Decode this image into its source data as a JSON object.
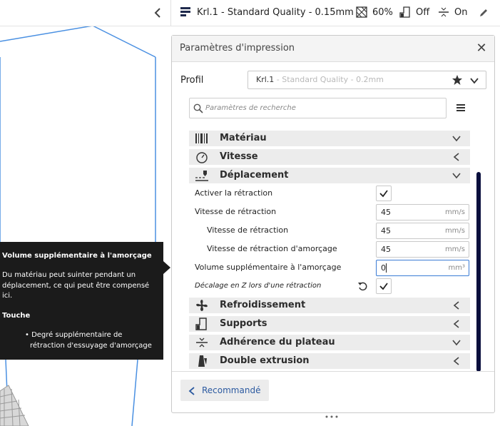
{
  "header": {
    "profile_text": "Krl.1 - Standard Quality - 0.15mm",
    "infill": "60%",
    "support": "Off",
    "adhesion": "On"
  },
  "panel": {
    "title": "Paramètres d'impression",
    "profile_label": "Profil",
    "profile_name": "Krl.1",
    "profile_suffix": " - Standard Quality - 0.2mm",
    "search_placeholder": "Paramètres de recherche",
    "categories": {
      "material": "Matériau",
      "speed": "Vitesse",
      "travel": "Déplacement",
      "cooling": "Refroidissement",
      "supports": "Supports",
      "adhesion": "Adhérence du plateau",
      "dual": "Double extrusion"
    },
    "settings": {
      "enable_retraction": "Activer la rétraction",
      "retraction_speed": "Vitesse de rétraction",
      "retraction_speed_value": "45",
      "retraction_retract_speed": "Vitesse de rétraction",
      "retraction_retract_speed_value": "45",
      "retraction_prime_speed": "Vitesse de rétraction d'amorçage",
      "retraction_prime_speed_value": "45",
      "extra_prime": "Volume supplémentaire à l'amorçage",
      "extra_prime_value": "0",
      "z_hop": "Décalage en Z lors d'une rétraction",
      "unit_speed": "mm/s",
      "unit_volume": "mm³"
    },
    "recommend_button": "Recommandé"
  },
  "tooltip": {
    "title": "Volume supplémentaire à l'amorçage",
    "body_line1": "Du matériau peut suinter pendant un",
    "body_line2": "déplacement, ce qui peut être compensé",
    "body_line3": "ici.",
    "affects_title": "Touche",
    "affects_line1": "• Degré supplémentaire de",
    "affects_line2": "rétraction d'essuyage d'amorçage"
  },
  "colors": {
    "accent_blue": "#2c5aa0",
    "scrollbar": "#0a0f3d",
    "tooltip_bg": "#1b1b1b",
    "wireframe": "#4a90e2"
  }
}
